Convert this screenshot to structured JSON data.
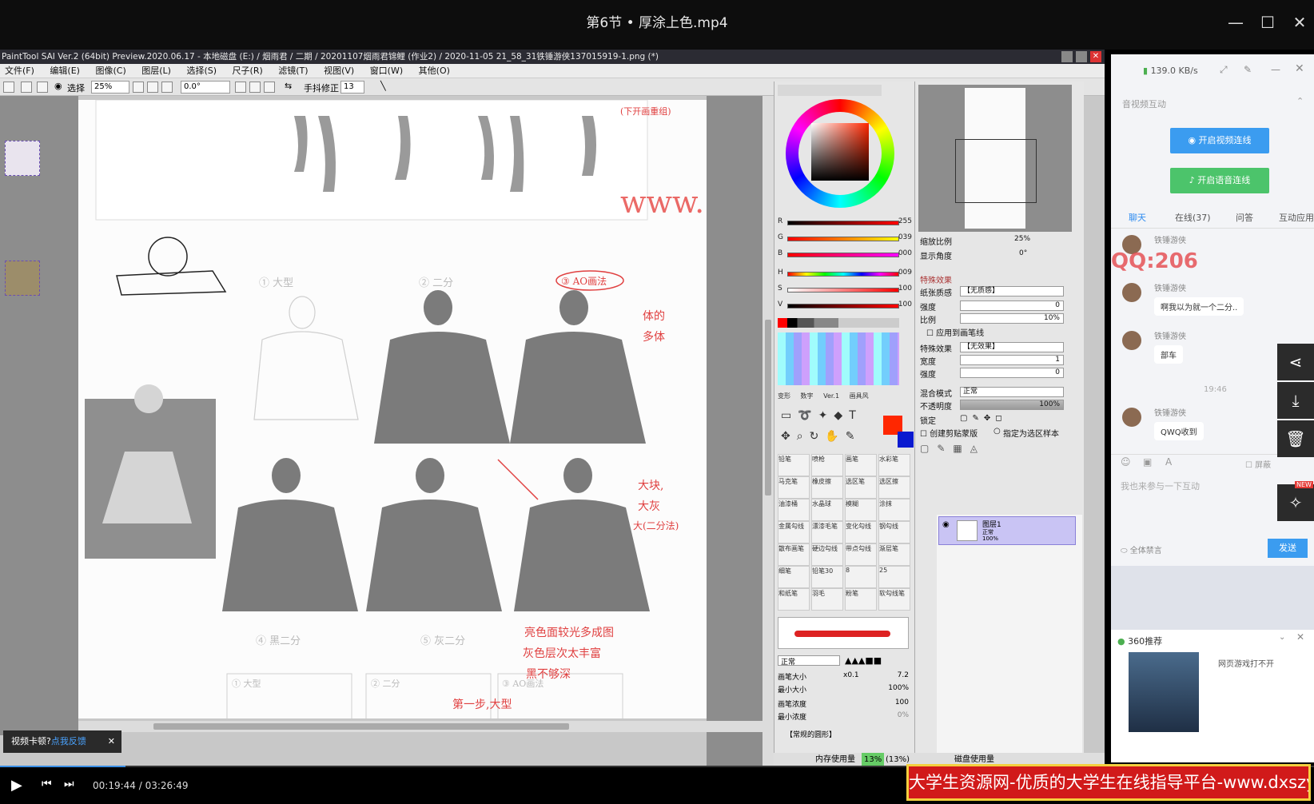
{
  "player": {
    "title": "第6节 • 厚涂上色.mp4",
    "time_current": "00:19:44",
    "time_total": "03:26:49",
    "time_separator": "/",
    "progress_fraction": 0.0955,
    "feedback_prefix": "视频卡顿?",
    "feedback_link": "点我反馈"
  },
  "sai": {
    "title": "PaintTool SAI Ver.2 (64bit) Preview.2020.06.17 - 本地磁盘 (E:) / 烟雨君 / 二期 / 20201107烟雨君锦鲤 (作业2) / 2020-11-05 21_58_31铁锤游侠137015919-1.png (*)",
    "menu": [
      "文件(F)",
      "编辑(E)",
      "图像(C)",
      "图层(L)",
      "选择(S)",
      "尺子(R)",
      "滤镜(T)",
      "视图(V)",
      "窗口(W)",
      "其他(O)"
    ],
    "toolbar": {
      "select_label": "选择",
      "zoom_value": "25%",
      "angle_value": "0.0°",
      "stabilizer_label": "手抖修正",
      "stabilizer_value": "13"
    },
    "canvas": {
      "watermark": "www. dxszyw. cn",
      "notes": {
        "top_right": "(下开画重组)",
        "ao_label": "③ AO画法",
        "shadow_note_1": "体的",
        "shadow_note_2": "多体",
        "big_shapes_1": "大块,",
        "big_shapes_2": "大灰",
        "big_shapes_3": "大(二分法)",
        "bottom_1": "亮色面较光多成图",
        "bottom_2": "灰色层次太丰富",
        "bottom_3": "黑不够深",
        "face_note": "第一步,大型"
      },
      "step_labels": {
        "step1": "① 大型",
        "step2": "② 二分",
        "step4": "④ 黑二分",
        "step5": "⑤ 灰二分",
        "face1": "① 大型",
        "face2": "② 二分",
        "face3": "③ AO画法"
      }
    },
    "color": {
      "rgb": [
        {
          "label": "R",
          "value": "255"
        },
        {
          "label": "G",
          "value": "039"
        },
        {
          "label": "B",
          "value": "000"
        }
      ],
      "hsv": [
        {
          "label": "H",
          "value": "009"
        },
        {
          "label": "S",
          "value": "100"
        },
        {
          "label": "V",
          "value": "100"
        }
      ],
      "primary": "#ff2700",
      "secondary": "#0a1ad0"
    },
    "tool_tabs": [
      "变形",
      "数字",
      "Ver.1",
      "画具风"
    ],
    "brushes": [
      "铅笔",
      "喷枪",
      "画笔",
      "水彩笔",
      "马克笔",
      "橡皮擦",
      "选区笔",
      "选区擦",
      "油漆桶",
      "水晶球",
      "模糊",
      "涂抹",
      "金属勾线",
      "漂漆毛笔",
      "变化勾线",
      "钢勾线",
      "散布画笔",
      "硬边勾线",
      "带点勾线",
      "渐层笔",
      "细笔",
      "铅笔30",
      "8",
      "25",
      "和纸笔",
      "羽毛",
      "粉笔",
      "软勾线笔"
    ],
    "brush_settings": {
      "blend_mode": "正常",
      "size_label": "画笔大小",
      "size_multiplier": "x0.1",
      "size_value": "7.2",
      "min_size_label": "最小大小",
      "min_size_value": "100%",
      "density_label": "画笔浓度",
      "density_value": "100",
      "min_density_label": "最小浓度",
      "min_density_value": "0%",
      "shape": "【常规的圆形】"
    },
    "navigator": {
      "zoom_label": "缩放比例",
      "zoom_value": "25%",
      "angle_label": "显示角度",
      "angle_value": "0°"
    },
    "layer_props": {
      "special_effects": "特殊效果",
      "texture_label": "纸张质感",
      "texture_value": "【无质感】",
      "strength_label": "强度",
      "strength_value": "0",
      "scale_label": "比例",
      "scale_value": "10%",
      "apply_label": "应用到画笔线",
      "effect_label": "特殊效果",
      "effect_value": "【无效果】",
      "width_label": "宽度",
      "width_value": "1",
      "strength2_label": "强度",
      "strength2_value": "0",
      "blend_label": "混合模式",
      "blend_value": "正常",
      "opacity_label": "不透明度",
      "opacity_value": "100%",
      "lock_label": "锁定",
      "clip_label": "创建剪贴蒙版",
      "sample_label": "指定为选区样本"
    },
    "layer": {
      "name": "图层1",
      "mode": "正常",
      "opacity": "100%"
    },
    "status": {
      "memory_label": "内存使用量",
      "memory_value": "13%",
      "memory_pct": "(13%)",
      "disk_label": "磁盘使用量"
    }
  },
  "chat": {
    "speed": "139.0 KB/s",
    "section": "音视频互动",
    "video_btn": "开启视频连线",
    "voice_btn": "开启语音连线",
    "tabs": [
      "聊天",
      "在线(37)",
      "问答",
      "互动应用"
    ],
    "messages": [
      {
        "name": "铁锤游侠",
        "text": ""
      },
      {
        "name": "铁锤游侠",
        "text": "啊我以为就一个二分.."
      },
      {
        "name": "铁锤游侠",
        "text": "部车"
      },
      {
        "name": "铁锤游侠",
        "text": "QWQ收到"
      }
    ],
    "timestamp": "19:46",
    "qq_watermark": "QQ:206",
    "block_label": "屏蔽",
    "input_placeholder": "我也来参与一下互动",
    "mute_all": "全体禁言",
    "send": "发送",
    "ad_title": "360推荐",
    "ad_text": "网页游戏打不开",
    "ad_badge": "NEW"
  },
  "banner": "大学生资源网-优质的大学生在线指导平台-www.dxszyw.cn"
}
